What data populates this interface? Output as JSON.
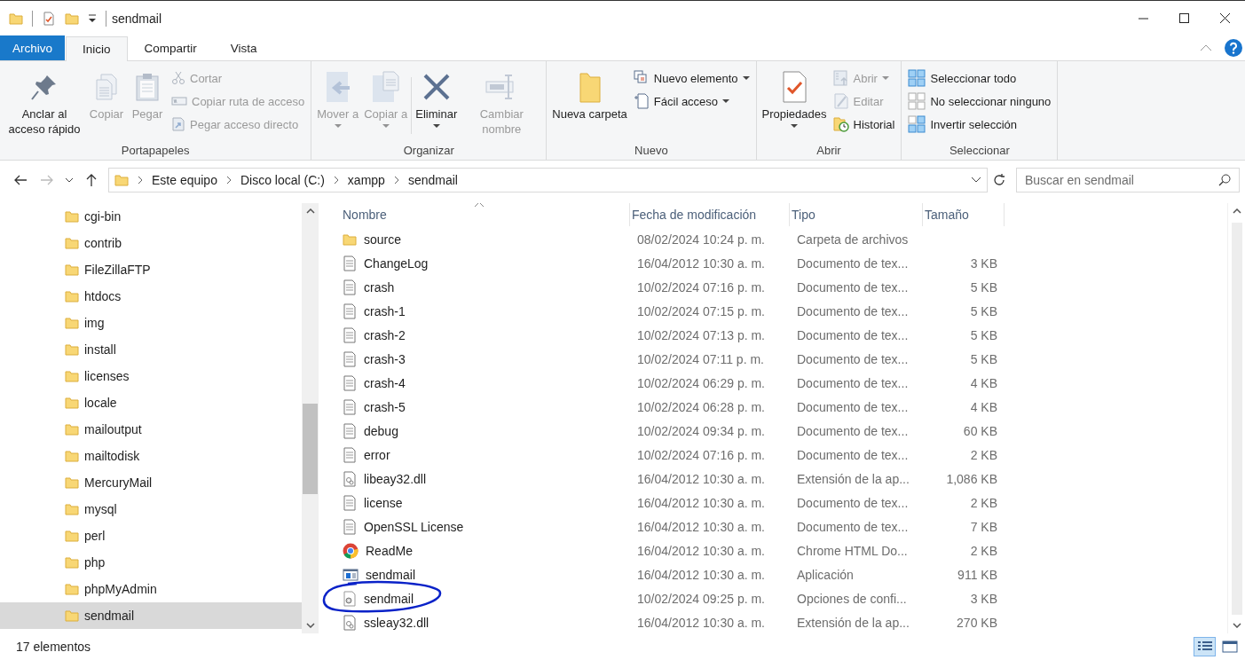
{
  "window": {
    "title": "sendmail"
  },
  "ribbon_tabs": [
    {
      "label": "Archivo",
      "kind": "file",
      "selected": false
    },
    {
      "label": "Inicio",
      "kind": "tab",
      "selected": true
    },
    {
      "label": "Compartir",
      "kind": "tab",
      "selected": false
    },
    {
      "label": "Vista",
      "kind": "tab",
      "selected": false
    }
  ],
  "ribbon_groups": [
    {
      "label": "Portapapeles",
      "items": [
        {
          "kind": "large",
          "label": "Anclar al acceso rápido",
          "disabled": false,
          "menu": false
        },
        {
          "kind": "large",
          "label": "Copiar",
          "disabled": true,
          "menu": false
        },
        {
          "kind": "large",
          "label": "Pegar",
          "disabled": true,
          "menu": false
        },
        {
          "kind": "small",
          "label": "Cortar",
          "disabled": true,
          "menu": false
        },
        {
          "kind": "small",
          "label": "Copiar ruta de acceso",
          "disabled": true,
          "menu": false
        },
        {
          "kind": "small",
          "label": "Pegar acceso directo",
          "disabled": true,
          "menu": false
        }
      ]
    },
    {
      "label": "Organizar",
      "items": [
        {
          "kind": "large",
          "label": "Mover a",
          "disabled": true,
          "menu": true
        },
        {
          "kind": "large",
          "label": "Copiar a",
          "disabled": true,
          "menu": true
        },
        {
          "kind": "large",
          "label": "Eliminar",
          "disabled": false,
          "menu": true
        },
        {
          "kind": "large",
          "label": "Cambiar nombre",
          "disabled": true,
          "menu": false
        }
      ]
    },
    {
      "label": "Nuevo",
      "items": [
        {
          "kind": "large",
          "label": "Nueva carpeta",
          "disabled": false,
          "menu": false
        },
        {
          "kind": "small",
          "label": "Nuevo elemento",
          "disabled": false,
          "menu": true
        },
        {
          "kind": "small",
          "label": "Fácil acceso",
          "disabled": false,
          "menu": true
        }
      ]
    },
    {
      "label": "Abrir",
      "items": [
        {
          "kind": "large",
          "label": "Propiedades",
          "disabled": false,
          "menu": true
        },
        {
          "kind": "small",
          "label": "Abrir",
          "disabled": true,
          "menu": true
        },
        {
          "kind": "small",
          "label": "Editar",
          "disabled": true,
          "menu": false
        },
        {
          "kind": "small",
          "label": "Historial",
          "disabled": false,
          "menu": false
        }
      ]
    },
    {
      "label": "Seleccionar",
      "items": [
        {
          "kind": "small",
          "label": "Seleccionar todo",
          "disabled": false,
          "menu": false
        },
        {
          "kind": "small",
          "label": "No seleccionar ninguno",
          "disabled": false,
          "menu": false
        },
        {
          "kind": "small",
          "label": "Invertir selección",
          "disabled": false,
          "menu": false
        }
      ]
    }
  ],
  "address": {
    "breadcrumbs": [
      "Este equipo",
      "Disco local (C:)",
      "xampp",
      "sendmail"
    ]
  },
  "search": {
    "placeholder": "Buscar en sendmail"
  },
  "sidebar": {
    "items": [
      {
        "label": "cgi-bin",
        "selected": false
      },
      {
        "label": "contrib",
        "selected": false
      },
      {
        "label": "FileZillaFTP",
        "selected": false
      },
      {
        "label": "htdocs",
        "selected": false
      },
      {
        "label": "img",
        "selected": false
      },
      {
        "label": "install",
        "selected": false
      },
      {
        "label": "licenses",
        "selected": false
      },
      {
        "label": "locale",
        "selected": false
      },
      {
        "label": "mailoutput",
        "selected": false
      },
      {
        "label": "mailtodisk",
        "selected": false
      },
      {
        "label": "MercuryMail",
        "selected": false
      },
      {
        "label": "mysql",
        "selected": false
      },
      {
        "label": "perl",
        "selected": false
      },
      {
        "label": "php",
        "selected": false
      },
      {
        "label": "phpMyAdmin",
        "selected": false
      },
      {
        "label": "sendmail",
        "selected": true
      }
    ]
  },
  "table": {
    "columns": [
      "Nombre",
      "Fecha de modificación",
      "Tipo",
      "Tamaño"
    ],
    "rows": [
      {
        "kind": "folder",
        "name": "source",
        "date": "08/02/2024 10:24 p. m.",
        "type": "Carpeta de archivos",
        "circled": false
      },
      {
        "kind": "text",
        "name": "ChangeLog",
        "date": "16/04/2012 10:30 a. m.",
        "type": "Documento de tex...",
        "size": "3 KB",
        "circled": false
      },
      {
        "kind": "text",
        "name": "crash",
        "date": "10/02/2024 07:16 p. m.",
        "type": "Documento de tex...",
        "size": "5 KB",
        "circled": false
      },
      {
        "kind": "text",
        "name": "crash-1",
        "date": "10/02/2024 07:15 p. m.",
        "type": "Documento de tex...",
        "size": "5 KB",
        "circled": false
      },
      {
        "kind": "text",
        "name": "crash-2",
        "date": "10/02/2024 07:13 p. m.",
        "type": "Documento de tex...",
        "size": "5 KB",
        "circled": false
      },
      {
        "kind": "text",
        "name": "crash-3",
        "date": "10/02/2024 07:11 p. m.",
        "type": "Documento de tex...",
        "size": "5 KB",
        "circled": false
      },
      {
        "kind": "text",
        "name": "crash-4",
        "date": "10/02/2024 06:29 p. m.",
        "type": "Documento de tex...",
        "size": "4 KB",
        "circled": false
      },
      {
        "kind": "text",
        "name": "crash-5",
        "date": "10/02/2024 06:28 p. m.",
        "type": "Documento de tex...",
        "size": "4 KB",
        "circled": false
      },
      {
        "kind": "text",
        "name": "debug",
        "date": "10/02/2024 09:34 p. m.",
        "type": "Documento de tex...",
        "size": "60 KB",
        "circled": false
      },
      {
        "kind": "text",
        "name": "error",
        "date": "10/02/2024 07:16 p. m.",
        "type": "Documento de tex...",
        "size": "2 KB",
        "circled": false
      },
      {
        "kind": "dll",
        "name": "libeay32.dll",
        "date": "16/04/2012 10:30 a. m.",
        "type": "Extensión de la ap...",
        "size": "1,086 KB",
        "circled": false
      },
      {
        "kind": "text",
        "name": "license",
        "date": "16/04/2012 10:30 a. m.",
        "type": "Documento de tex...",
        "size": "2 KB",
        "circled": false
      },
      {
        "kind": "text",
        "name": "OpenSSL License",
        "date": "16/04/2012 10:30 a. m.",
        "type": "Documento de tex...",
        "size": "7 KB",
        "circled": false
      },
      {
        "kind": "browser",
        "name": "ReadMe",
        "date": "16/04/2012 10:30 a. m.",
        "type": "Chrome HTML Do...",
        "size": "2 KB",
        "circled": false
      },
      {
        "kind": "app",
        "name": "sendmail",
        "date": "16/04/2012 10:30 a. m.",
        "type": "Aplicación",
        "size": "911 KB",
        "circled": false
      },
      {
        "kind": "config",
        "name": "sendmail",
        "date": "10/02/2024 09:25 p. m.",
        "type": "Opciones de confi...",
        "size": "3 KB",
        "circled": true
      },
      {
        "kind": "dll",
        "name": "ssleay32.dll",
        "date": "16/04/2012 10:30 a. m.",
        "type": "Extensión de la ap...",
        "size": "270 KB",
        "circled": false
      }
    ]
  },
  "status_bar": {
    "count": "17 elementos",
    "views": [
      {
        "kind": "details",
        "selected": true
      },
      {
        "kind": "large-icons",
        "selected": false
      }
    ]
  }
}
